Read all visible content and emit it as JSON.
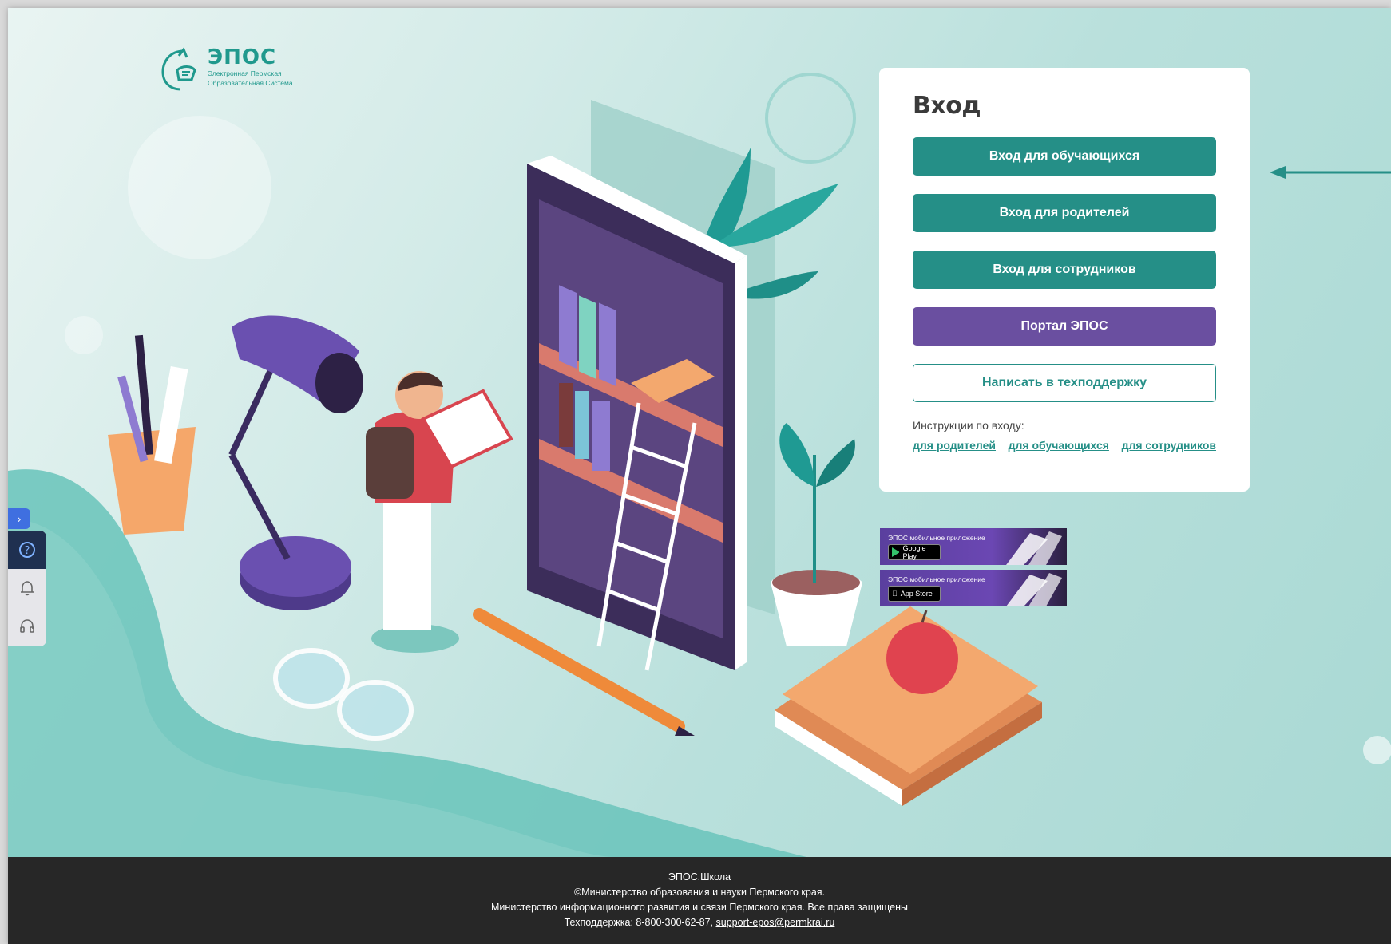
{
  "logo": {
    "title": "ЭПОС",
    "subtitle_line1": "Электронная Пермская",
    "subtitle_line2": "Образовательная Система"
  },
  "login": {
    "title": "Вход",
    "buttons": {
      "students": "Вход для обучающихся",
      "parents": "Вход для родителей",
      "staff": "Вход для сотрудников",
      "portal": "Портал ЭПОС",
      "support": "Написать в техподдержку"
    },
    "instructions_label": "Инструкции по входу:",
    "instruction_links": {
      "parents": "для родителей",
      "students": "для обучающихся",
      "staff": "для сотрудников"
    }
  },
  "apps": {
    "google_play": {
      "caption": "ЭПОС мобильное приложение",
      "store": "Google Play"
    },
    "app_store": {
      "caption": "ЭПОС мобильное приложение",
      "store": "App Store"
    }
  },
  "sidebar": {
    "icons": [
      "help-icon",
      "bell-icon",
      "headset-icon"
    ],
    "toggle_glyph": "›"
  },
  "footer": {
    "line1": "ЭПОС.Школа",
    "line2": "©Министерство образования и науки Пермского края.",
    "line3": "Министерство информационного развития и связи Пермского края. Все права защищены",
    "support_prefix": "Техподдержка: 8-800-300-62-87,",
    "support_email": "support-epos@permkrai.ru"
  },
  "colors": {
    "accent_teal": "#258f87",
    "accent_purple": "#6a4fa0",
    "footer_bg": "#272727"
  }
}
